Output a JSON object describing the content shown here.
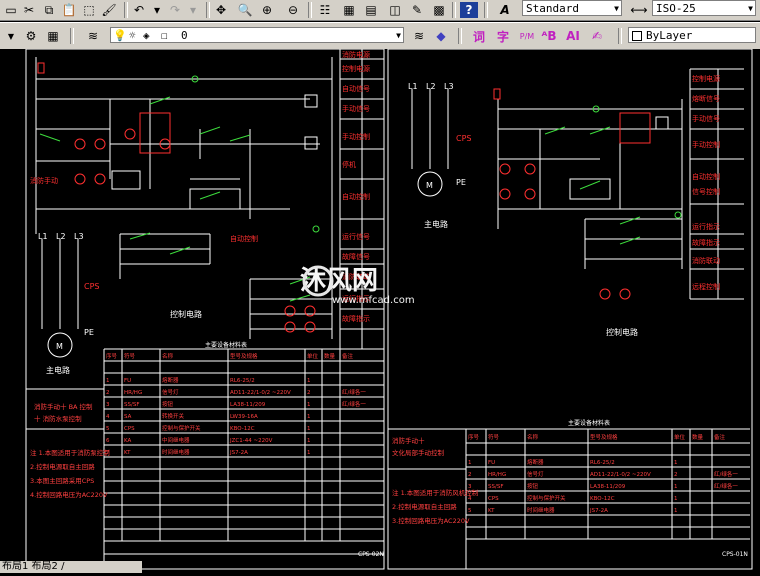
{
  "toolbar_top": {
    "text_style": "Standard",
    "dim_style": "ISO-25"
  },
  "toolbar_layer": {
    "layer_value": "0",
    "color_value": "ByLayer",
    "text_buttons": [
      "词",
      "字"
    ]
  },
  "drawing": {
    "watermark_brand": "沐风网",
    "watermark_url": "www.mfcad.com",
    "left_labels": {
      "motor": "M",
      "main_circuit": "主电路",
      "control_circuit": "控制电路",
      "fuse_cps": "CPS",
      "l1": "L1",
      "l2": "L2",
      "l3": "L3",
      "pe": "PE"
    },
    "right_labels": {
      "motor": "M",
      "main_circuit": "主电路",
      "control_circuit": "控制电路",
      "fuse_cps": "CPS",
      "l1": "L1",
      "l2": "L2",
      "l3": "L3",
      "pe": "PE"
    },
    "left_title": "主要设备材料表",
    "right_title": "主要设备材料表",
    "table_headers": [
      "序号",
      "符号",
      "名称",
      "型号及规格",
      "单位",
      "数量",
      "备注"
    ],
    "left_rows": [
      [
        "1",
        "FU",
        "熔断器",
        "RL6-25/2",
        "1",
        "",
        ""
      ],
      [
        "2",
        "HR/HG",
        "信号灯",
        "AD11-22/1-0/2 ~220V",
        "2",
        "",
        "红/绿各一"
      ],
      [
        "3",
        "SS/SF",
        "按钮",
        "LA38-11/209",
        "1",
        "",
        "红/绿各一"
      ],
      [
        "4",
        "SA",
        "转换开关",
        "LW39-16A",
        "1",
        "",
        ""
      ],
      [
        "5",
        "CPS",
        "控制与保护开关",
        "KBO-12C",
        "1",
        "",
        ""
      ],
      [
        "6",
        "KA",
        "中间继电器",
        "JZC1-44 ~220V",
        "1",
        "",
        ""
      ],
      [
        "7",
        "KT",
        "时间继电器",
        "JS7-2A",
        "1",
        "",
        ""
      ]
    ],
    "right_rows": [
      [
        "1",
        "FU",
        "熔断器",
        "RL6-25/2",
        "1",
        "",
        ""
      ],
      [
        "2",
        "HR/HG",
        "信号灯",
        "AD11-22/1-0/2 ~220V",
        "2",
        "",
        "红/绿各一"
      ],
      [
        "3",
        "SS/SF",
        "按钮",
        "LA38-11/209",
        "1",
        "",
        "红/绿各一"
      ],
      [
        "4",
        "CPS",
        "控制与保护开关",
        "KBO-12C",
        "1",
        "",
        ""
      ],
      [
        "5",
        "KT",
        "时间继电器",
        "JS7-2A",
        "1",
        "",
        ""
      ]
    ],
    "left_title_block": "消防手动十 BA 控制\n十 消防水泵控制",
    "right_title_block": "消防手动十\n文化局部手动控制",
    "left_dwg_no": "CPS-02N",
    "right_dwg_no": "CPS-01N",
    "left_notes": [
      "注 1.本图适用于消防泵控制",
      "2.控制电源取自主回路",
      "3.本图主回路采用CPS",
      "4.控制回路电压为AC220V"
    ],
    "right_notes": [
      "注 1.本图适用于消防风机控制",
      "2.控制电源取自主回路",
      "3.控制回路电压为AC220V"
    ]
  },
  "status_bar": {
    "text": "布局1 布局2 /"
  }
}
